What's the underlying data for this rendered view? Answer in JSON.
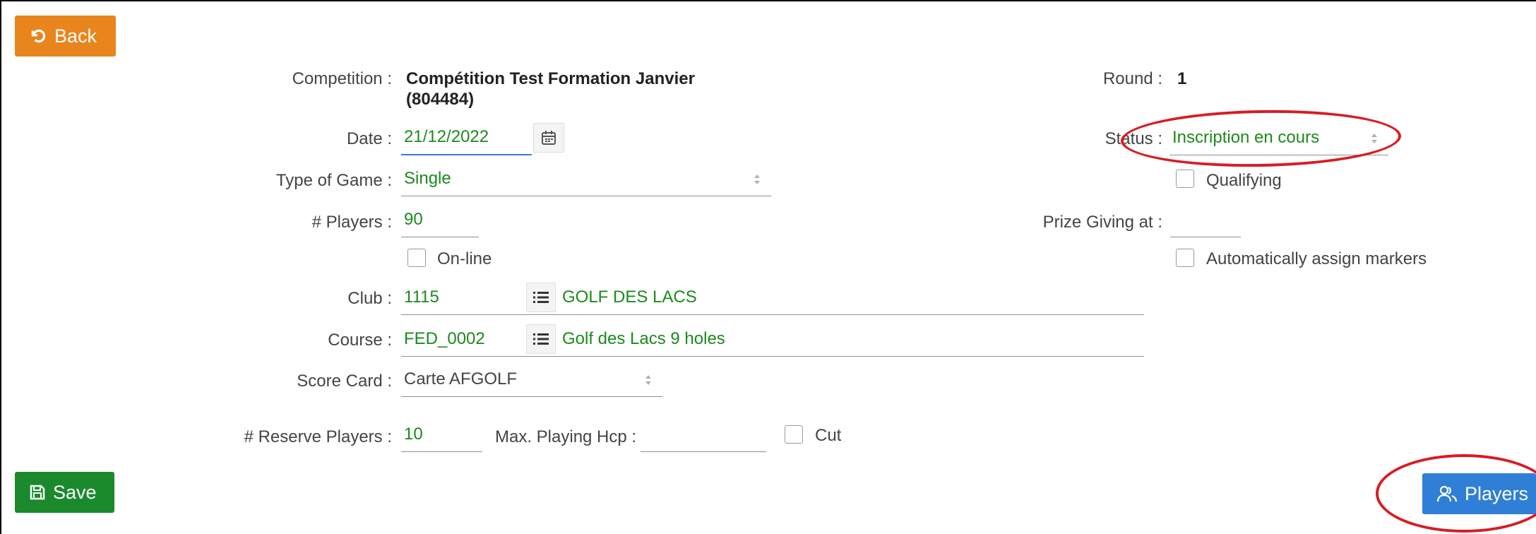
{
  "buttons": {
    "back": "Back",
    "save": "Save",
    "players": "Players"
  },
  "form": {
    "competition_label": "Competition :",
    "competition_value_line1": "Compétition Test Formation Janvier",
    "competition_value_line2": "(804484)",
    "round_label": "Round :",
    "round_value": "1",
    "date_label": "Date :",
    "date_value": "21/12/2022",
    "status_label": "Status :",
    "status_value": "Inscription en cours",
    "type_label": "Type of Game :",
    "type_value": "Single",
    "qualifying_label": "Qualifying",
    "players_label": "# Players :",
    "players_value": "90",
    "prize_label": "Prize Giving at :",
    "prize_value": "",
    "online_label": "On-line",
    "auto_markers_label": "Automatically assign markers",
    "club_label": "Club :",
    "club_code": "1115",
    "club_name": "GOLF DES LACS",
    "course_label": "Course :",
    "course_code": "FED_0002",
    "course_name": "Golf des Lacs 9 holes",
    "scorecard_label": "Score Card :",
    "scorecard_value": "Carte AFGOLF",
    "reserve_label": "# Reserve Players :",
    "reserve_value": "10",
    "maxhcp_label": "Max. Playing Hcp :",
    "maxhcp_value": "",
    "cut_label": "Cut"
  },
  "colors": {
    "accent_green": "#1c8a1c",
    "back_orange": "#e9851d",
    "save_green": "#1a8a2c",
    "players_blue": "#2f7fd6",
    "highlight_red": "#d81c23"
  },
  "icons": {
    "back": "undo-icon",
    "save": "floppy-disk-icon",
    "players": "users-icon",
    "date": "calendar-icon",
    "list": "list-icon"
  }
}
